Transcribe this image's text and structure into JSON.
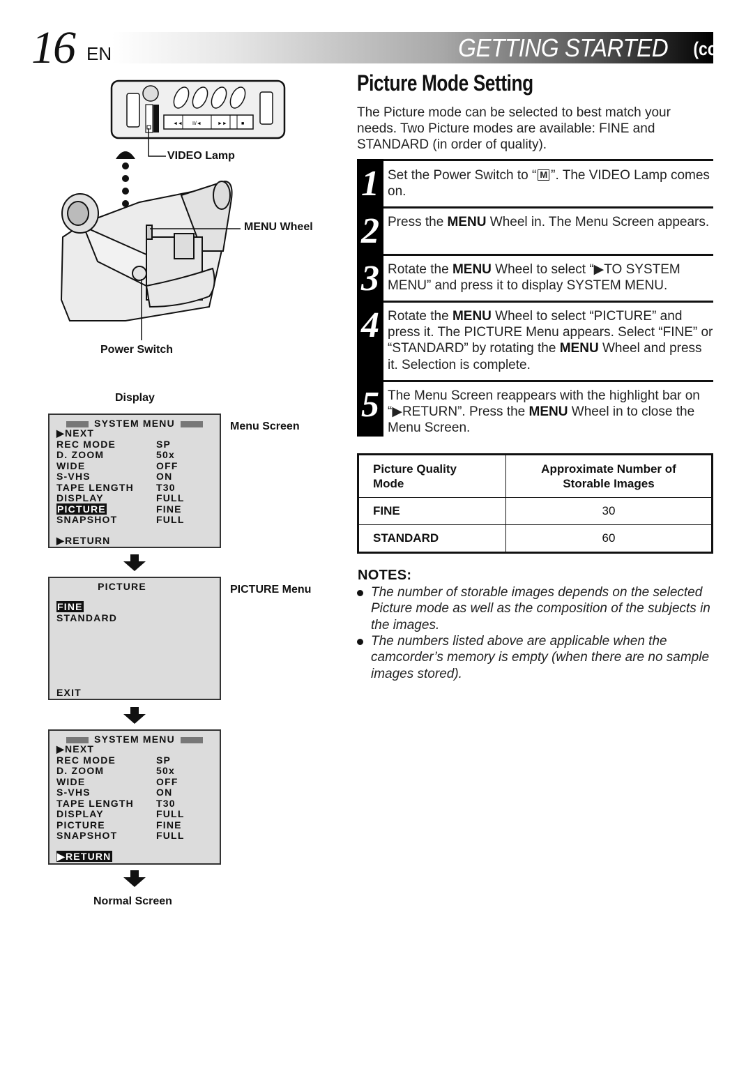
{
  "header": {
    "page_number": "16",
    "language": "EN",
    "section": "GETTING STARTED",
    "continued": "(cont.)"
  },
  "illustration": {
    "callouts": {
      "video_lamp": "VIDEO Lamp",
      "menu_wheel": "MENU Wheel",
      "power_switch": "Power Switch"
    },
    "panel_buttons": [
      "◄◄",
      "II/◄",
      "►►",
      "■"
    ]
  },
  "display_label": "Display",
  "screens": {
    "menu_screen": {
      "label": "Menu Screen",
      "title": "SYSTEM MENU",
      "next": "▶NEXT",
      "rows": [
        {
          "item": "REC MODE",
          "value": "SP"
        },
        {
          "item": "D. ZOOM",
          "value": "50x"
        },
        {
          "item": "WIDE",
          "value": "OFF"
        },
        {
          "item": "S-VHS",
          "value": "ON"
        },
        {
          "item": "TAPE LENGTH",
          "value": "T30"
        },
        {
          "item": "DISPLAY",
          "value": "FULL"
        },
        {
          "item": "PICTURE",
          "value": "FINE"
        },
        {
          "item": "SNAPSHOT",
          "value": "FULL"
        }
      ],
      "highlighted": "PICTURE",
      "return": "▶RETURN"
    },
    "picture_menu": {
      "label": "PICTURE Menu",
      "title": "PICTURE",
      "options": [
        "FINE",
        "STANDARD"
      ],
      "highlighted": "FINE",
      "exit": "EXIT"
    },
    "menu_screen_return": {
      "title": "SYSTEM MENU",
      "next": "▶NEXT",
      "rows": [
        {
          "item": "REC MODE",
          "value": "SP"
        },
        {
          "item": "D. ZOOM",
          "value": "50x"
        },
        {
          "item": "WIDE",
          "value": "OFF"
        },
        {
          "item": "S-VHS",
          "value": "ON"
        },
        {
          "item": "TAPE LENGTH",
          "value": "T30"
        },
        {
          "item": "DISPLAY",
          "value": "FULL"
        },
        {
          "item": "PICTURE",
          "value": "FINE"
        },
        {
          "item": "SNAPSHOT",
          "value": "FULL"
        }
      ],
      "return": "▶RETURN",
      "highlighted": "▶RETURN"
    },
    "normal_screen_label": "Normal Screen"
  },
  "section": {
    "title": "Picture Mode Setting",
    "intro": "The Picture mode can be selected to best match your needs. Two Picture modes are available:  FINE and STANDARD (in order of quality)."
  },
  "steps": [
    {
      "num": "1",
      "parts": [
        "Set the Power Switch to “",
        "M",
        "”. The VIDEO Lamp comes on."
      ]
    },
    {
      "num": "2",
      "parts": [
        "Press the ",
        "MENU",
        " Wheel in. The Menu Screen appears."
      ]
    },
    {
      "num": "3",
      "parts": [
        "Rotate the ",
        "MENU",
        " Wheel to select “▶TO SYSTEM MENU” and press it to display SYSTEM MENU."
      ]
    },
    {
      "num": "4",
      "parts": [
        "Rotate the ",
        "MENU",
        " Wheel to select “PICTURE” and press it. The PICTURE Menu appears. Select “FINE” or “STANDARD” by rotating the ",
        "MENU",
        " Wheel and press it. Selection is complete."
      ]
    },
    {
      "num": "5",
      "parts": [
        "The Menu Screen reappears with the highlight bar on “▶RETURN”. Press the ",
        "MENU",
        " Wheel in to close the Menu Screen."
      ]
    }
  ],
  "table": {
    "headers": [
      "Picture Quality Mode",
      "Approximate Number of Storable Images"
    ],
    "header_lines": [
      [
        "Picture Quality",
        "Mode"
      ],
      [
        "Approximate Number of",
        "Storable Images"
      ]
    ],
    "rows": [
      {
        "mode": "FINE",
        "images": "30"
      },
      {
        "mode": "STANDARD",
        "images": "60"
      }
    ]
  },
  "notes": {
    "title": "NOTES:",
    "items": [
      "The number of storable images depends on the selected Picture mode as well as the composition of the subjects in the images.",
      "The numbers listed above are applicable when the camcorder’s memory is empty (when there are no sample images stored)."
    ]
  }
}
